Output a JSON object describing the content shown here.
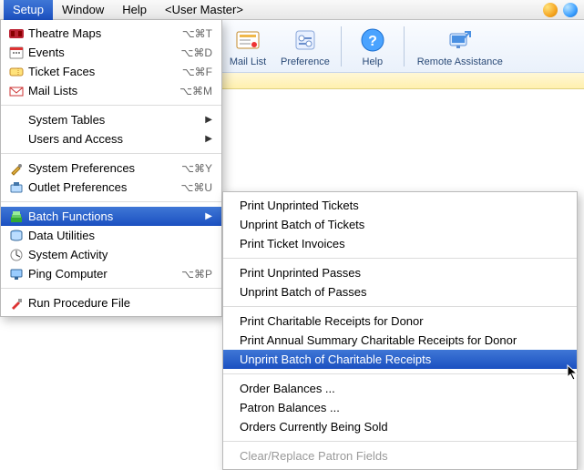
{
  "menubar": {
    "items": [
      "Setup",
      "Window",
      "Help",
      "<User Master>"
    ]
  },
  "toolbar": {
    "buttons": [
      {
        "label": "Mail List",
        "icon": "mail-list-icon"
      },
      {
        "label": "Preference",
        "icon": "preference-icon"
      },
      {
        "label": "Help",
        "icon": "help-icon"
      },
      {
        "label": "Remote Assistance",
        "icon": "remote-assistance-icon"
      }
    ]
  },
  "setup_menu": {
    "section1": [
      {
        "label": "Theatre Maps",
        "shortcut": "⌥⌘T",
        "icon": "theatre-maps-icon"
      },
      {
        "label": "Events",
        "shortcut": "⌥⌘D",
        "icon": "events-icon"
      },
      {
        "label": "Ticket Faces",
        "shortcut": "⌥⌘F",
        "icon": "ticket-faces-icon"
      },
      {
        "label": "Mail Lists",
        "shortcut": "⌥⌘M",
        "icon": "mail-lists-icon"
      }
    ],
    "section2": [
      {
        "label": "System Tables",
        "submenu": true
      },
      {
        "label": "Users and Access",
        "submenu": true
      }
    ],
    "section3": [
      {
        "label": "System Preferences",
        "shortcut": "⌥⌘Y",
        "icon": "system-preferences-icon"
      },
      {
        "label": "Outlet Preferences",
        "shortcut": "⌥⌘U",
        "icon": "outlet-preferences-icon"
      }
    ],
    "section4": [
      {
        "label": "Batch Functions",
        "submenu": true,
        "icon": "batch-functions-icon",
        "highlight": true
      },
      {
        "label": "Data Utilities",
        "icon": "data-utilities-icon"
      },
      {
        "label": "System Activity",
        "icon": "system-activity-icon"
      },
      {
        "label": "Ping Computer",
        "shortcut": "⌥⌘P",
        "icon": "ping-computer-icon"
      }
    ],
    "section5": [
      {
        "label": "Run Procedure File",
        "icon": "run-procedure-icon"
      }
    ]
  },
  "batch_submenu": {
    "groups": [
      [
        "Print Unprinted Tickets",
        "Unprint Batch of Tickets",
        "Print Ticket Invoices"
      ],
      [
        "Print Unprinted Passes",
        "Unprint Batch of Passes"
      ],
      [
        "Print Charitable Receipts for Donor",
        "Print Annual Summary Charitable Receipts for Donor",
        "Unprint Batch of Charitable Receipts"
      ],
      [
        "Order Balances ...",
        "Patron Balances ...",
        "Orders Currently Being Sold"
      ],
      [
        "Clear/Replace Patron Fields"
      ]
    ],
    "highlighted": "Unprint Batch of Charitable Receipts",
    "disabled": [
      "Clear/Replace Patron Fields"
    ]
  },
  "colors": {
    "highlight": "#2a5fcf"
  }
}
